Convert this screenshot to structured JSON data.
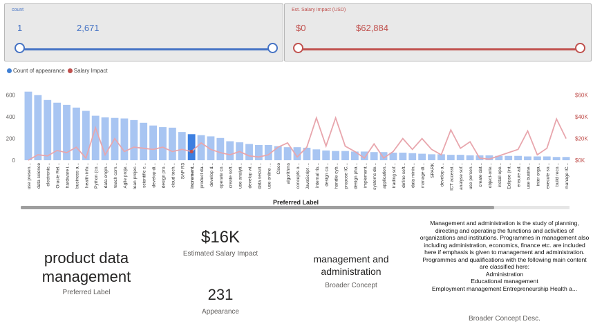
{
  "slicers": {
    "count": {
      "title": "count",
      "min": "1",
      "max": "2,671",
      "color": "#4472c4"
    },
    "salary": {
      "title": "Est. Salary Impact (USD)",
      "min": "$0",
      "max": "$62,884",
      "color": "#c0504d"
    }
  },
  "legend": [
    {
      "label": "Count of appearance",
      "color": "#3f7fd4"
    },
    {
      "label": "Salary Impact",
      "color": "#c0504d"
    }
  ],
  "chart_data": {
    "type": "bar+line",
    "xlabel": "Preferred Label",
    "bar_color": "#a8c5f2",
    "highlight_color": "#3d7fe0",
    "line_color": "#e8a6ad",
    "highlight_index": 17,
    "y_left": {
      "ticks": [
        "0",
        "200",
        "400",
        "600"
      ],
      "range": [
        0,
        700
      ]
    },
    "y_right": {
      "ticks": [
        "$0K",
        "$20K",
        "$40K",
        "$60K"
      ],
      "range": [
        0,
        70000
      ]
    },
    "categories": [
      "use presen...",
      "data science",
      "electronic...",
      "Oracle Rel...",
      "hardware i...",
      "business a...",
      "health info...",
      "Python (co...",
      "data engin...",
      "teach com...",
      "Agile proje...",
      "lean projec...",
      "scientific c...",
      "develop di...",
      "design pro...",
      "cloud tech...",
      "SAP R3",
      "increment...",
      "product da...",
      "develop d...",
      "operate co...",
      "create soft...",
      "use analyti...",
      "develop wi...",
      "data securi...",
      "use online ...",
      "Cisco",
      "algorithms",
      "concepts o...",
      "JavaScript ...",
      "internal ris...",
      "design co...",
      "handle cyb...",
      "propose IC...",
      "design pha...",
      "implement...",
      "systems de...",
      "application...",
      "trading sof...",
      "define soft...",
      "data minin...",
      "manage di...",
      "SPARK",
      "develop a...",
      "ICT accessi...",
      "analyse sof...",
      "use person...",
      "create dat...",
      "object-orie...",
      "install ope...",
      "Eclipse (int...",
      "ensure ad...",
      "use busine...",
      "inter orga...",
      "execute so...",
      "build reco...",
      "manage IC..."
    ],
    "counts": [
      632,
      600,
      555,
      530,
      510,
      485,
      455,
      410,
      395,
      390,
      385,
      370,
      345,
      320,
      305,
      300,
      260,
      240,
      231,
      220,
      205,
      175,
      165,
      150,
      140,
      140,
      130,
      120,
      120,
      115,
      100,
      90,
      85,
      85,
      80,
      80,
      75,
      75,
      70,
      70,
      65,
      60,
      55,
      55,
      50,
      50,
      45,
      45,
      45,
      40,
      40,
      40,
      35,
      35,
      35,
      30,
      30
    ],
    "salary": [
      0,
      5000,
      4000,
      9000,
      7000,
      12000,
      2000,
      30000,
      5000,
      20000,
      8000,
      12000,
      11000,
      10000,
      12000,
      8000,
      10000,
      8000,
      16000,
      10000,
      7000,
      5000,
      8000,
      4000,
      3000,
      5000,
      12000,
      16000,
      3000,
      12000,
      39000,
      13000,
      39000,
      13000,
      8000,
      2000,
      15000,
      2000,
      8000,
      20000,
      10000,
      20000,
      10000,
      5000,
      28000,
      11000,
      17000,
      2000,
      1000,
      4000,
      7000,
      10000,
      27000,
      5000,
      11000,
      38000,
      20000
    ]
  },
  "cards": {
    "label_value": "product data management",
    "label_caption": "Preferred Label",
    "salary_value": "$16K",
    "salary_caption": "Estimated Salary Impact",
    "count_value": "231",
    "count_caption": "Appearance",
    "concept_value": "management and administration",
    "concept_caption": "Broader Concept",
    "desc_text": "Management and administration is the study of planning, directing and operating the functions and activities of organizations and institutions. Programmes in management also including administration, economics, finance etc. are included here if emphasis is given to management and administration.\nProgrammes and qualifications with the following main content are classified here:\nAdministration\nEducational management\nEmployment management Entrepreneurship Health a...",
    "desc_caption": "Broader Concept Desc."
  }
}
